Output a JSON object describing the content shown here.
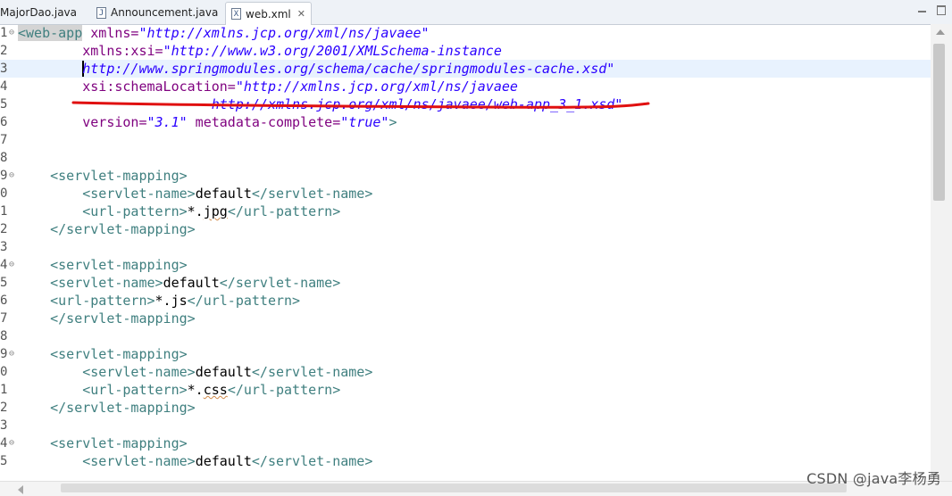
{
  "tabs": [
    {
      "label": "MajorDao.java",
      "icon": "java-file-icon",
      "active": false
    },
    {
      "label": "Announcement.java",
      "icon": "java-file-icon",
      "active": false
    },
    {
      "label": "web.xml",
      "icon": "xml-file-icon",
      "active": true,
      "close": "✕"
    }
  ],
  "editor": {
    "gutter": [
      "1",
      "2",
      "3",
      "4",
      "5",
      "6",
      "7",
      "8",
      "9",
      "0",
      "1",
      "2",
      "3",
      "4",
      "5",
      "6",
      "7",
      "8",
      "9",
      "0",
      "1",
      "2",
      "3",
      "4",
      "5"
    ],
    "lines": [
      {
        "t1": "<web-app",
        "t2": " xmlns=",
        "v": "\"http://xmlns.jcp.org/xml/ns/javaee\""
      },
      {
        "ind": "        ",
        "a": "xmlns:xsi=",
        "v": "\"http://www.w3.org/2001/XMLSchema-instance"
      },
      {
        "ind": "        ",
        "v": "http://www.springmodules.org/schema/cache/springmodules-cache.xsd\""
      },
      {
        "ind": "        ",
        "a": "xsi:schemaLocation=",
        "v": "\"http://xmlns.jcp.org/xml/ns/javaee"
      },
      {
        "ind": "                        ",
        "v": "http://xmlns.jcp.org/xml/ns/javaee/web-app_3_1.xsd\""
      },
      {
        "ind": "        ",
        "a": "version=",
        "v": "\"3.1\"",
        "a2": " metadata-complete=",
        "v2": "\"true\"",
        "t": ">"
      },
      {},
      {},
      {
        "ind": "    ",
        "t": "<servlet-mapping>"
      },
      {
        "ind": "        ",
        "t": "<servlet-name>",
        "x": "default",
        "t2": "</servlet-name>"
      },
      {
        "ind": "        ",
        "t": "<url-pattern>",
        "x": "*.",
        "xs": "jpg",
        "t2": "</url-pattern>"
      },
      {
        "ind": "    ",
        "t": "</servlet-mapping>"
      },
      {},
      {
        "ind": "    ",
        "t": "<servlet-mapping>"
      },
      {
        "ind": "    ",
        "t": "<servlet-name>",
        "x": "default",
        "t2": "</servlet-name>"
      },
      {
        "ind": "    ",
        "t": "<url-pattern>",
        "x": "*.js",
        "t2": "</url-pattern>"
      },
      {
        "ind": "    ",
        "t": "</servlet-mapping>"
      },
      {},
      {
        "ind": "    ",
        "t": "<servlet-mapping>"
      },
      {
        "ind": "        ",
        "t": "<servlet-name>",
        "x": "default",
        "t2": "</servlet-name>"
      },
      {
        "ind": "        ",
        "t": "<url-pattern>",
        "x": "*.",
        "xs": "css",
        "t2": "</url-pattern>"
      },
      {
        "ind": "    ",
        "t": "</servlet-mapping>"
      },
      {},
      {
        "ind": "    ",
        "t": "<servlet-mapping>"
      },
      {
        "ind": "        ",
        "t": "<servlet-name>",
        "x": "default",
        "t2": "</servlet-name>"
      }
    ]
  },
  "watermark": "CSDN @java李杨勇",
  "colors": {
    "annotation": "#e01010"
  }
}
